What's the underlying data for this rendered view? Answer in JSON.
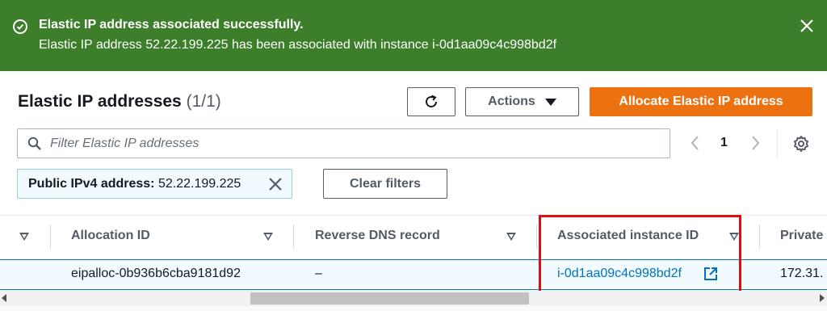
{
  "flash": {
    "title": "Elastic IP address associated successfully.",
    "message": "Elastic IP address 52.22.199.225 has been associated with instance i-0d1aa09c4c998bd2f",
    "status": "success",
    "bg_color": "#3c7e2a"
  },
  "header": {
    "title": "Elastic IP addresses",
    "count": "(1/1)",
    "actions_label": "Actions",
    "allocate_label": "Allocate Elastic IP address",
    "accent_color": "#ec7211"
  },
  "filter": {
    "placeholder": "Filter Elastic IP addresses",
    "value": ""
  },
  "pagination": {
    "current_page": "1"
  },
  "token": {
    "key": "Public IPv4 address:",
    "value": "52.22.199.225"
  },
  "clear_filters_label": "Clear filters",
  "table": {
    "columns": [
      "Allocation ID",
      "Reverse DNS record",
      "Associated instance ID",
      "Private"
    ],
    "rows": [
      {
        "allocation_id": "eipalloc-0b936b6cba9181d92",
        "reverse_dns": "–",
        "instance_id": "i-0d1aa09c4c998bd2f",
        "private": "172.31."
      }
    ]
  },
  "icons": {
    "flash": "success-check-icon",
    "dismiss": "close-icon",
    "refresh": "refresh-icon",
    "search": "search-icon",
    "settings": "gear-icon",
    "external": "external-link-icon"
  }
}
